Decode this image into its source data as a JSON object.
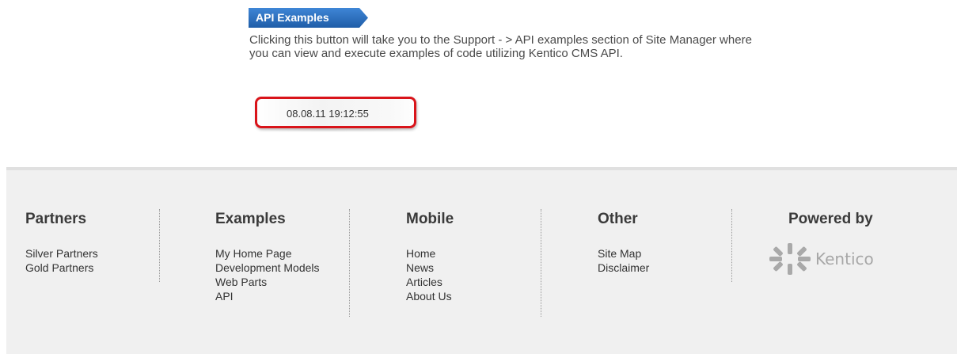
{
  "api_button": {
    "label": "API Examples",
    "color": "#2f6fb6"
  },
  "description": "Clicking this button will take you to the Support - > API examples section of Site Manager where you can view and execute examples of code utilizing Kentico CMS API.",
  "timestamp": "08.08.11 19:12:55",
  "highlight_color": "#d9141a",
  "footer": {
    "columns": [
      {
        "title": "Partners",
        "links": [
          "Silver Partners",
          "Gold Partners"
        ]
      },
      {
        "title": "Examples",
        "links": [
          "My Home Page",
          "Development Models",
          "Web Parts",
          "API"
        ]
      },
      {
        "title": "Mobile",
        "links": [
          "Home",
          "News",
          "Articles",
          "About Us"
        ]
      },
      {
        "title": "Other",
        "links": [
          "Site Map",
          "Disclaimer"
        ]
      },
      {
        "title": "Powered by",
        "links": []
      }
    ],
    "logo": {
      "text": "Kentico",
      "icon": "kentico-logo-icon"
    }
  }
}
